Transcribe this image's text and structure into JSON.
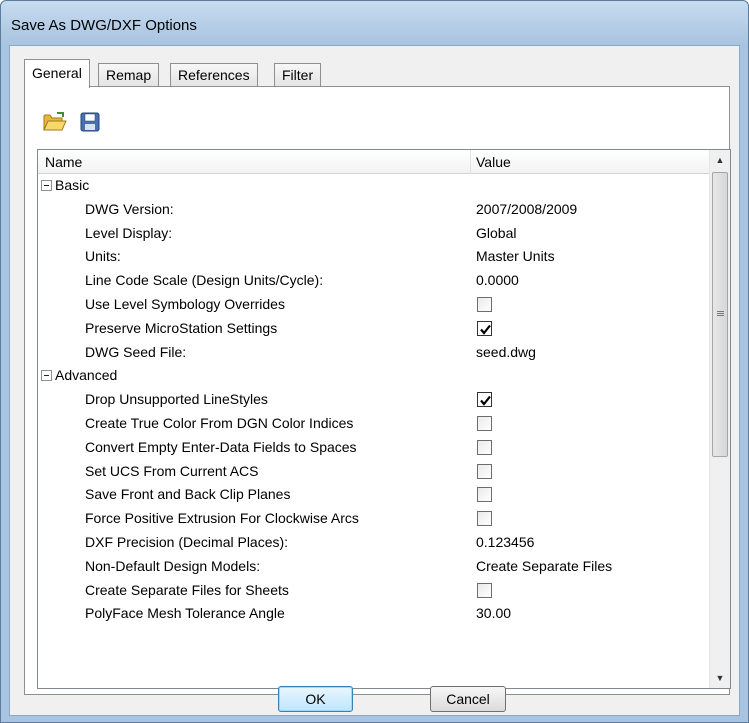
{
  "window": {
    "title": "Save As DWG/DXF Options"
  },
  "tabs": [
    {
      "label": "General",
      "active": true
    },
    {
      "label": "Remap",
      "active": false
    },
    {
      "label": "References",
      "active": false
    },
    {
      "label": "Filter",
      "active": false
    }
  ],
  "toolbar": {
    "open_icon": "folder-open-icon",
    "save_icon": "floppy-disk-icon"
  },
  "grid": {
    "header": {
      "name": "Name",
      "value": "Value"
    },
    "categories": [
      {
        "label": "Basic",
        "expanded": true,
        "rows": [
          {
            "name": "DWG Version:",
            "type": "text",
            "value": "2007/2008/2009"
          },
          {
            "name": "Level Display:",
            "type": "text",
            "value": "Global"
          },
          {
            "name": "Units:",
            "type": "text",
            "value": "Master Units"
          },
          {
            "name": "Line Code Scale (Design Units/Cycle):",
            "type": "text",
            "value": "0.0000"
          },
          {
            "name": "Use Level Symbology Overrides",
            "type": "checkbox",
            "checked": false
          },
          {
            "name": "Preserve MicroStation Settings",
            "type": "checkbox",
            "checked": true
          },
          {
            "name": "DWG Seed File:",
            "type": "text",
            "value": "seed.dwg"
          }
        ]
      },
      {
        "label": "Advanced",
        "expanded": true,
        "rows": [
          {
            "name": "Drop Unsupported LineStyles",
            "type": "checkbox",
            "checked": true
          },
          {
            "name": "Create True Color From DGN Color Indices",
            "type": "checkbox",
            "checked": false
          },
          {
            "name": "Convert Empty Enter-Data Fields to Spaces",
            "type": "checkbox",
            "checked": false
          },
          {
            "name": "Set UCS From Current ACS",
            "type": "checkbox",
            "checked": false
          },
          {
            "name": "Save Front and Back Clip Planes",
            "type": "checkbox",
            "checked": false
          },
          {
            "name": "Force Positive Extrusion For Clockwise Arcs",
            "type": "checkbox",
            "checked": false
          },
          {
            "name": "DXF Precision (Decimal Places):",
            "type": "text",
            "value": "0.123456"
          },
          {
            "name": "Non-Default Design Models:",
            "type": "text",
            "value": "Create Separate Files"
          },
          {
            "name": "Create Separate Files for Sheets",
            "type": "checkbox",
            "checked": false
          },
          {
            "name": "PolyFace Mesh Tolerance Angle",
            "type": "text",
            "value": "30.00"
          }
        ]
      }
    ]
  },
  "buttons": {
    "ok": "OK",
    "cancel": "Cancel"
  },
  "colors": {
    "title_bar": "#a9c4e0",
    "dialog_bg": "#f0f0f0",
    "default_button": "#bee6fd"
  }
}
